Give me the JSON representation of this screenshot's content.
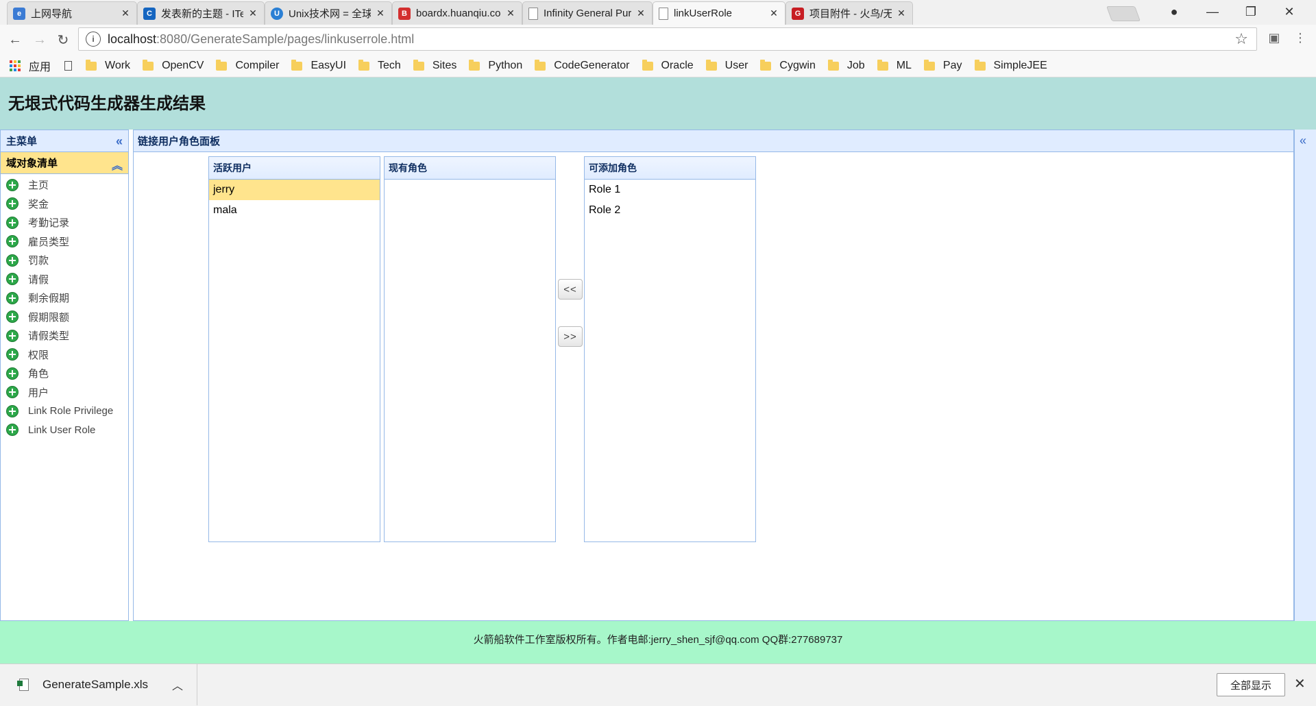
{
  "browser": {
    "tabs": [
      {
        "title": "上网导航",
        "favicon": "ie-icon",
        "color": "#3b7bd4",
        "active": false
      },
      {
        "title": "发表新的主题 - ITeye论",
        "favicon": "iteye-icon",
        "color": "#1565c0",
        "active": false
      },
      {
        "title": "Unix技术网 = 全球最大",
        "favicon": "unix-icon",
        "color": "#2a7fd4",
        "active": false
      },
      {
        "title": "boardx.huanqiu.com/",
        "favicon": "huanqiu-icon",
        "color": "#d32f2f",
        "active": false
      },
      {
        "title": "Infinity General Purpo",
        "favicon": "page-icon",
        "color": "#9e9e9e",
        "active": false
      },
      {
        "title": "linkUserRole",
        "favicon": "page-icon",
        "color": "#9e9e9e",
        "active": true
      },
      {
        "title": "项目附件 - 火鸟/无垠式",
        "favicon": "gitee-icon",
        "color": "#c71d23",
        "active": false
      }
    ],
    "url_host": "localhost",
    "url_path": ":8080/GenerateSample/pages/linkuserrole.html",
    "bookmarks": {
      "apps_label": "应用",
      "items": [
        "Work",
        "OpenCV",
        "Compiler",
        "EasyUI",
        "Tech",
        "Sites",
        "Python",
        "CodeGenerator",
        "Oracle",
        "User",
        "Cygwin",
        "Job",
        "ML",
        "Pay",
        "SimpleJEE"
      ]
    }
  },
  "page": {
    "header_title": "无垠式代码生成器生成结果",
    "west": {
      "title": "主菜单",
      "accordion_title": "域对象清单",
      "menu_items": [
        "主页",
        "奖金",
        "考勤记录",
        "雇员类型",
        "罚款",
        "请假",
        "剩余假期",
        "假期限额",
        "请假类型",
        "权限",
        "角色",
        "用户",
        "Link Role Privilege",
        "Link User Role"
      ]
    },
    "center": {
      "title": "链接用户角色面板",
      "active_users": {
        "title": "活跃用户",
        "rows": [
          "jerry",
          "mala"
        ],
        "selected": "jerry"
      },
      "current_roles": {
        "title": "现有角色",
        "rows": []
      },
      "addable_roles": {
        "title": "可添加角色",
        "rows": [
          "Role 1",
          "Role 2"
        ]
      },
      "move_left_label": "<<",
      "move_right_label": ">>"
    },
    "footer_text": "火箭船软件工作室版权所有。作者电邮:jerry_shen_sjf@qq.com QQ群:277689737"
  },
  "downloads": {
    "file_name": "GenerateSample.xls",
    "show_all_label": "全部显示"
  },
  "colors": {
    "header_bg": "#b2dfdb",
    "footer_bg": "#a7f7ca",
    "panel_header_bg": "#e0ecff",
    "selection_bg": "#ffe48d",
    "panel_border": "#95b8e7"
  }
}
